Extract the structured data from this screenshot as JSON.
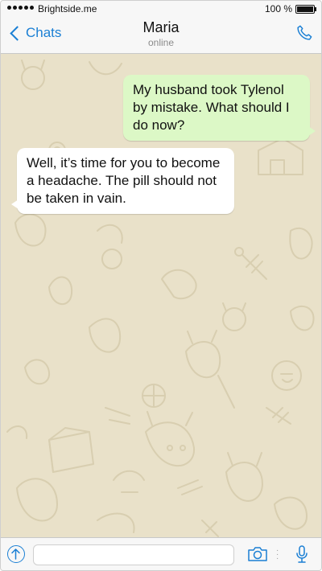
{
  "status_bar": {
    "carrier": "Brightside.me",
    "time": "",
    "battery_percent": "100 %",
    "battery_level": 1.0
  },
  "header": {
    "back_label": "Chats",
    "contact_name": "Maria",
    "presence": "online",
    "call_icon": "phone-icon"
  },
  "messages": [
    {
      "direction": "outgoing",
      "text": "My husband took Tylenol by mistake. What should I do now?"
    },
    {
      "direction": "incoming",
      "text": "Well, it’s time for you to become a headache. The pill should not be taken in vain."
    }
  ],
  "composer": {
    "placeholder": "",
    "value": "",
    "icons": [
      "upload-icon",
      "camera-icon",
      "microphone-icon"
    ]
  },
  "colors": {
    "accent": "#1a7fd4",
    "outgoing_bubble": "#dcf8c6",
    "incoming_bubble": "#ffffff",
    "chat_background": "#e9e1c9"
  }
}
